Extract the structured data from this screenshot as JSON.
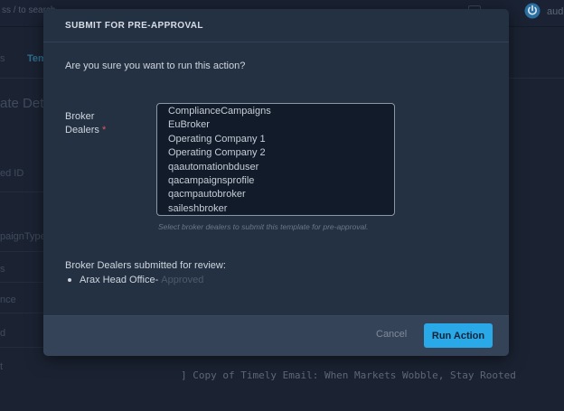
{
  "background": {
    "search_placeholder": "ss / to search",
    "user_label": "aud",
    "breadcrumb": [
      "s",
      "Tem"
    ],
    "page_title": "ate Det",
    "field_labels": [
      "ed ID",
      "paignType",
      "s",
      "nce",
      "d",
      "t"
    ],
    "template_name_value": "] Copy of Timely Email: When Markets Wobble, Stay Rooted"
  },
  "modal": {
    "title": "SUBMIT FOR PRE-APPROVAL",
    "confirm_text": "Are you sure you want to run this action?",
    "field": {
      "label_line1": "Broker",
      "label_line2": "Dealers",
      "required_mark": "*",
      "options": [
        "ComplianceCampaigns",
        "EuBroker",
        "Operating Company 1",
        "Operating Company 2",
        "qaautomationbduser",
        "qacampaignsprofile",
        "qacmpautobroker",
        "saileshbroker"
      ],
      "help_text": "Select broker dealers to submit this template for pre-approval."
    },
    "submitted": {
      "heading": "Broker Dealers submitted for review:",
      "items": [
        {
          "name": "Arax Head Office",
          "separator": " -",
          "status": "Approved"
        }
      ]
    },
    "footer": {
      "cancel_label": "Cancel",
      "run_label": "Run Action"
    }
  },
  "colors": {
    "accent": "#29a9e8",
    "modal_bg": "#243142",
    "footer_bg": "#354359",
    "required": "#e05a5a"
  }
}
